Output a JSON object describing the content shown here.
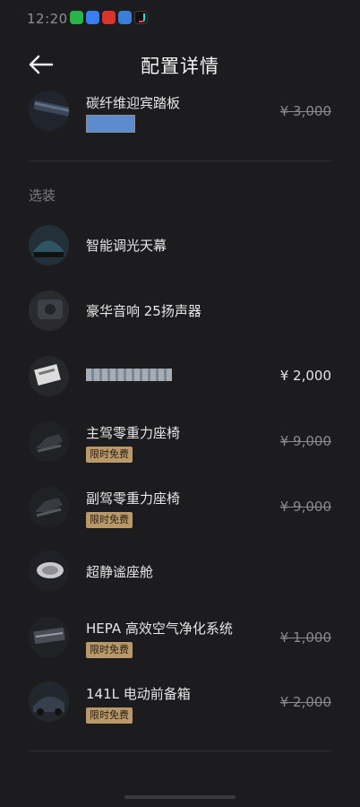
{
  "status_bar": {
    "time": "12:20",
    "app_icons": [
      "wechat-icon",
      "alipay-icon",
      "news-icon",
      "tool-icon",
      "tiktok-icon"
    ]
  },
  "header": {
    "back_icon": "arrow-left-icon",
    "title": "配置详情"
  },
  "standard_item": {
    "name": "碳纤维迎宾踏板",
    "price": "¥ 3,000",
    "price_struck": true,
    "swatch_color": "#5a8ccf"
  },
  "options_section": {
    "label": "选装",
    "items": [
      {
        "name": "智能调光天幕",
        "price": "",
        "price_struck": false,
        "badge": ""
      },
      {
        "name": "豪华音响 25扬声器",
        "price": "",
        "price_struck": false,
        "badge": ""
      },
      {
        "name": "",
        "price": "¥ 2,000",
        "price_struck": false,
        "badge": ""
      },
      {
        "name": "主驾零重力座椅",
        "price": "¥ 9,000",
        "price_struck": true,
        "badge": "限时免费"
      },
      {
        "name": "副驾零重力座椅",
        "price": "¥ 9,000",
        "price_struck": true,
        "badge": "限时免费"
      },
      {
        "name": "超静谧座舱",
        "price": "",
        "price_struck": false,
        "badge": ""
      },
      {
        "name": "HEPA 高效空气净化系统",
        "price": "¥ 1,000",
        "price_struck": true,
        "badge": "限时免费"
      },
      {
        "name": "141L 电动前备箱",
        "price": "¥ 2,000",
        "price_struck": true,
        "badge": "限时免费"
      }
    ]
  },
  "colors": {
    "background": "#1c1c1e",
    "badge": "#b9996a",
    "struck_price": "#8a8a8e"
  }
}
